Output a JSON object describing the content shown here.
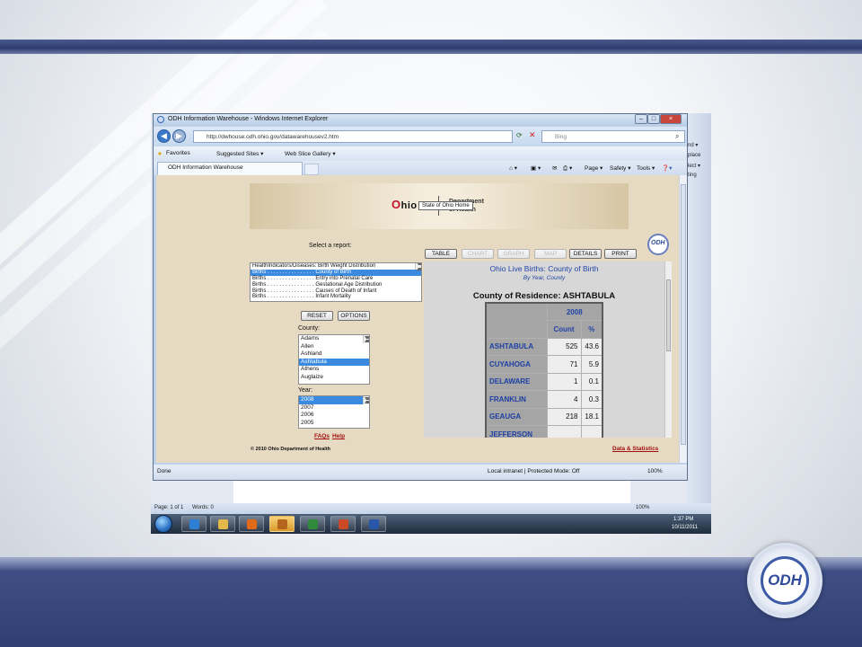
{
  "browser": {
    "window_title": "ODH Information Warehouse - Windows Internet Explorer",
    "url": "http://dwhouse.odh.ohio.gov/datawarehousev2.htm",
    "search_placeholder": "Bing",
    "favorites_label": "Favorites",
    "suggested_sites_label": "Suggested Sites ▾",
    "web_slice_label": "Web Slice Gallery ▾",
    "tab_title": "ODH Information Warehouse",
    "command_page": "Page ▾",
    "command_safety": "Safety ▾",
    "command_tools": "Tools ▾",
    "status_text": "Done",
    "zone_text": "Local intranet | Protected Mode: Off",
    "zoom": "100%"
  },
  "banner": {
    "ohio_o": "O",
    "ohio_rest": "hio",
    "dept_line1": "Department",
    "dept_line2": "of Health",
    "tooltip": "State of Ohio Home"
  },
  "form": {
    "select_report_label": "Select a report:",
    "reports": [
      "HealthIndicators/Diseases: Birth Weight Distribution",
      "Births . . . . . . . . . . . . . . . . County of Birth",
      "Births . . . . . . . . . . . . . . . . Entry into Prenatal Care",
      "Births . . . . . . . . . . . . . . . . Gestational Age Distribution",
      "Births . . . . . . . . . . . . . . . . Causes of Death of Infant",
      "Births . . . . . . . . . . . . . . . . Infant Mortality"
    ],
    "reset_label": "RESET",
    "options_label": "OPTIONS",
    "county_label": "County:",
    "counties": [
      "Adams",
      "Allen",
      "Ashland",
      "Ashtabula",
      "Athens",
      "Auglaize"
    ],
    "year_label": "Year:",
    "years": [
      "2008",
      "2007",
      "2006",
      "2005"
    ],
    "faqs_label": "FAQs",
    "help_label": "Help",
    "copyright": "© 2010 Ohio Department of Health",
    "data_stats_label": "Data & Statistics"
  },
  "view_buttons": {
    "table": "TABLE",
    "chart": "CHART",
    "graph": "GRAPH",
    "map": "MAP",
    "details": "DETAILS",
    "print": "PRINT"
  },
  "report": {
    "title": "Ohio Live Births: County of Birth",
    "subtitle": "By Year, County",
    "county_heading": "County of Residence: ASHTABULA",
    "year_header": "2008",
    "count_header": "Count",
    "pct_header": "%",
    "rows": [
      {
        "county": "ASHTABULA",
        "count": "525",
        "pct": "43.6"
      },
      {
        "county": "CUYAHOGA",
        "count": "71",
        "pct": "5.9"
      },
      {
        "county": "DELAWARE",
        "count": "1",
        "pct": "0.1"
      },
      {
        "county": "FRANKLIN",
        "count": "4",
        "pct": "0.3"
      },
      {
        "county": "GEAUGA",
        "count": "218",
        "pct": "18.1"
      },
      {
        "county": "JEFFERSON",
        "count": "",
        "pct": ""
      }
    ]
  },
  "word": {
    "status_page": "Page: 1 of 1",
    "status_words": "Words: 0",
    "zoom": "100%",
    "ribbon_fragments": [
      "nd ▾",
      "place",
      "lect ▾",
      "ting"
    ]
  },
  "taskbar": {
    "time": "1:37 PM",
    "date": "10/11/2011"
  }
}
